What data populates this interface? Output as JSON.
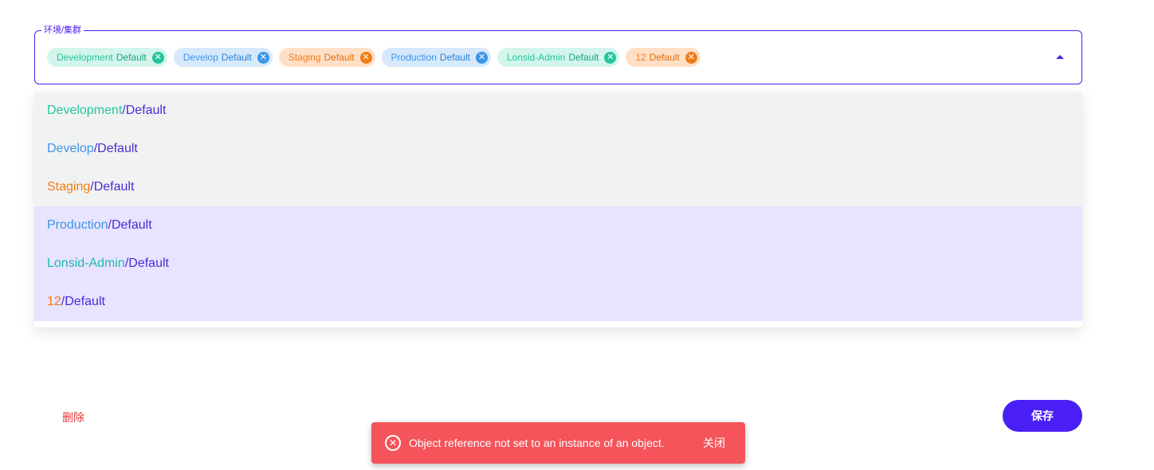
{
  "field": {
    "label": "环境/集群",
    "chips": [
      {
        "env": "Development",
        "cluster": "Default",
        "color": "teal"
      },
      {
        "env": "Develop",
        "cluster": "Default",
        "color": "blue"
      },
      {
        "env": "Staging",
        "cluster": "Default",
        "color": "orange"
      },
      {
        "env": "Production",
        "cluster": "Default",
        "color": "blue"
      },
      {
        "env": "Lonsid-Admin",
        "cluster": "Default",
        "color": "teal"
      },
      {
        "env": "12",
        "cluster": "Default",
        "color": "orange"
      }
    ],
    "close_glyph": "✕"
  },
  "menu": {
    "separator": "/",
    "items": [
      {
        "env": "Development",
        "cluster": "Default",
        "highlight": false
      },
      {
        "env": "Develop",
        "cluster": "Default",
        "highlight": false
      },
      {
        "env": "Staging",
        "cluster": "Default",
        "highlight": false
      },
      {
        "env": "Production",
        "cluster": "Default",
        "highlight": true
      },
      {
        "env": "Lonsid-Admin",
        "cluster": "Default",
        "highlight": true
      },
      {
        "env": "12",
        "cluster": "Default",
        "highlight": true
      }
    ]
  },
  "actions": {
    "delete_label": "删除",
    "save_label": "保存"
  },
  "toast": {
    "icon": "close-circle-icon",
    "icon_glyph": "✕",
    "message": "Object reference not set to an instance of an object.",
    "close_label": "关闭"
  },
  "colors": {
    "accent": "#4f1ff0",
    "teal": "#24c69c",
    "blue": "#3b95e9",
    "orange": "#f17b16",
    "error": "#f4545a"
  }
}
